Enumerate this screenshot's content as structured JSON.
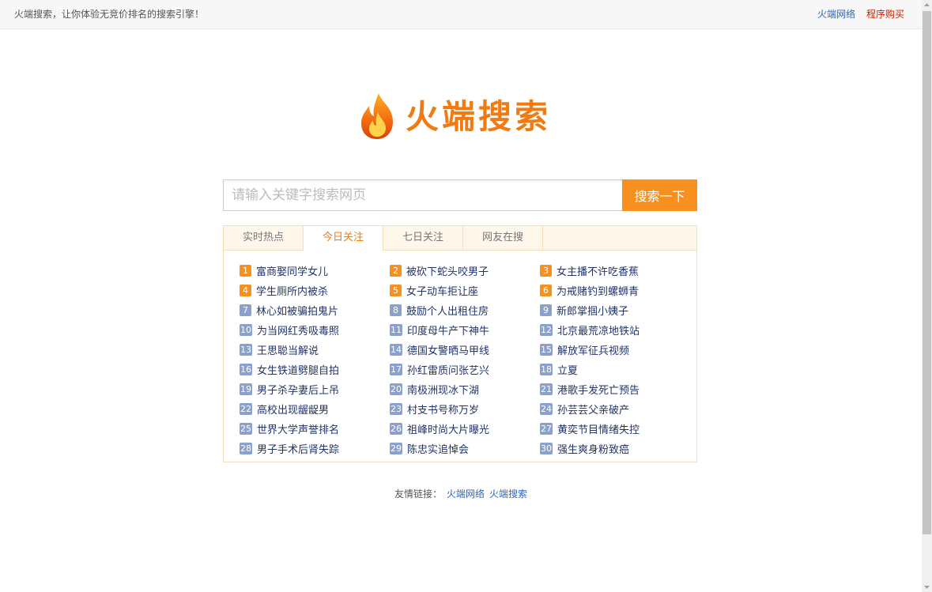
{
  "topbar": {
    "tagline": "火端搜索，让你体验无竞价排名的搜索引擎！",
    "link_network": "火端网络",
    "link_buy": "程序购买"
  },
  "logo": {
    "text": "火端搜索"
  },
  "search": {
    "placeholder": "请输入关键字搜索网页",
    "value": "",
    "button_label": "搜索一下"
  },
  "tabs": [
    {
      "label": "实时热点",
      "active": false
    },
    {
      "label": "今日关注",
      "active": true
    },
    {
      "label": "七日关注",
      "active": false
    },
    {
      "label": "网友在搜",
      "active": false
    }
  ],
  "hot_items": [
    {
      "num": "1",
      "text": "富商娶同学女儿"
    },
    {
      "num": "2",
      "text": "被砍下蛇头咬男子"
    },
    {
      "num": "3",
      "text": "女主播不许吃香蕉"
    },
    {
      "num": "4",
      "text": "学生厕所内被杀"
    },
    {
      "num": "5",
      "text": "女子动车拒让座"
    },
    {
      "num": "6",
      "text": "为戒赌钓到螺蛳青"
    },
    {
      "num": "7",
      "text": "林心如被骗拍鬼片"
    },
    {
      "num": "8",
      "text": "鼓励个人出租住房"
    },
    {
      "num": "9",
      "text": "新郎掌掴小姨子"
    },
    {
      "num": "10",
      "text": "为当网红秀吸毒照"
    },
    {
      "num": "11",
      "text": "印度母牛产下神牛"
    },
    {
      "num": "12",
      "text": "北京最荒凉地铁站"
    },
    {
      "num": "13",
      "text": "王思聪当解说"
    },
    {
      "num": "14",
      "text": "德国女警晒马甲线"
    },
    {
      "num": "15",
      "text": "解放军征兵视频"
    },
    {
      "num": "16",
      "text": "女生铁道劈腿自拍"
    },
    {
      "num": "17",
      "text": "孙红雷质问张艺兴"
    },
    {
      "num": "18",
      "text": "立夏"
    },
    {
      "num": "19",
      "text": "男子杀孕妻后上吊"
    },
    {
      "num": "20",
      "text": "南极洲现冰下湖"
    },
    {
      "num": "21",
      "text": "港歌手发死亡预告"
    },
    {
      "num": "22",
      "text": "高校出现龌龊男"
    },
    {
      "num": "23",
      "text": "村支书号称万岁"
    },
    {
      "num": "24",
      "text": "孙芸芸父亲破产"
    },
    {
      "num": "25",
      "text": "世界大学声誉排名"
    },
    {
      "num": "26",
      "text": "祖峰时尚大片曝光"
    },
    {
      "num": "27",
      "text": "黄奕节目情绪失控"
    },
    {
      "num": "28",
      "text": "男子手术后肾失踪"
    },
    {
      "num": "29",
      "text": "陈忠实追悼会"
    },
    {
      "num": "30",
      "text": "强生爽身粉致癌"
    }
  ],
  "footer": {
    "label": "友情链接：",
    "links": [
      "火端网络",
      "火端搜索"
    ]
  },
  "colors": {
    "accent": "#f7901e",
    "hot_badge": "#f7901e",
    "cold_badge": "#8ca0cc",
    "link": "#223366"
  }
}
